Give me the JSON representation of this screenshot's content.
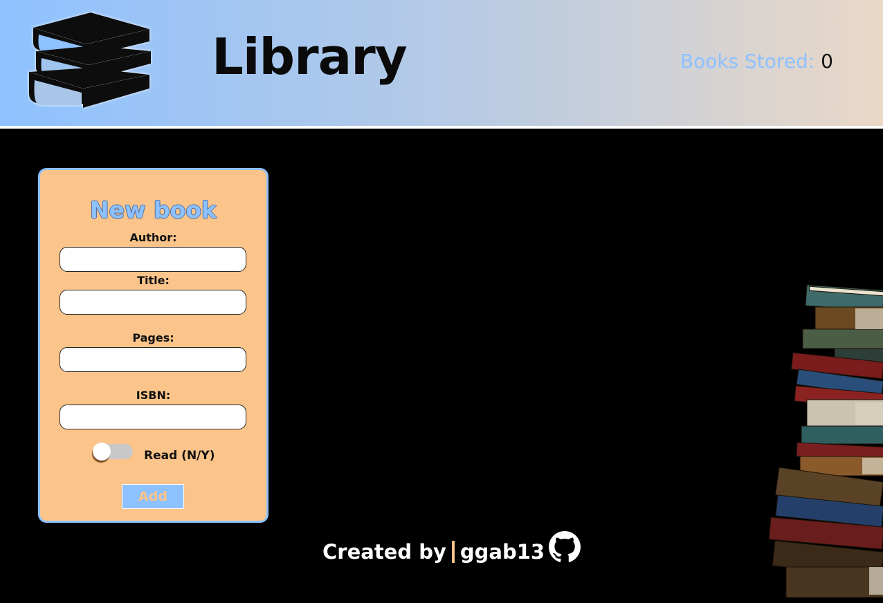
{
  "header": {
    "title": "Library",
    "books_stored_label": "Books Stored: ",
    "books_stored_count": "0"
  },
  "form": {
    "title": "New book",
    "author_label": "Author:",
    "author_value": "",
    "title_label": "Title:",
    "title_value": "",
    "pages_label": "Pages:",
    "pages_value": "",
    "isbn_label": "ISBN:",
    "isbn_value": "",
    "read_label": "Read (N/Y)",
    "read_checked": false,
    "add_label": "Add"
  },
  "footer": {
    "created_by": "Created by",
    "author": "ggab13"
  },
  "colors": {
    "accent_blue": "#8ec1ff",
    "accent_orange": "#fbc48a",
    "background": "#000000"
  },
  "icons": [
    "books-logo-icon",
    "github-icon",
    "book-stack-image"
  ]
}
